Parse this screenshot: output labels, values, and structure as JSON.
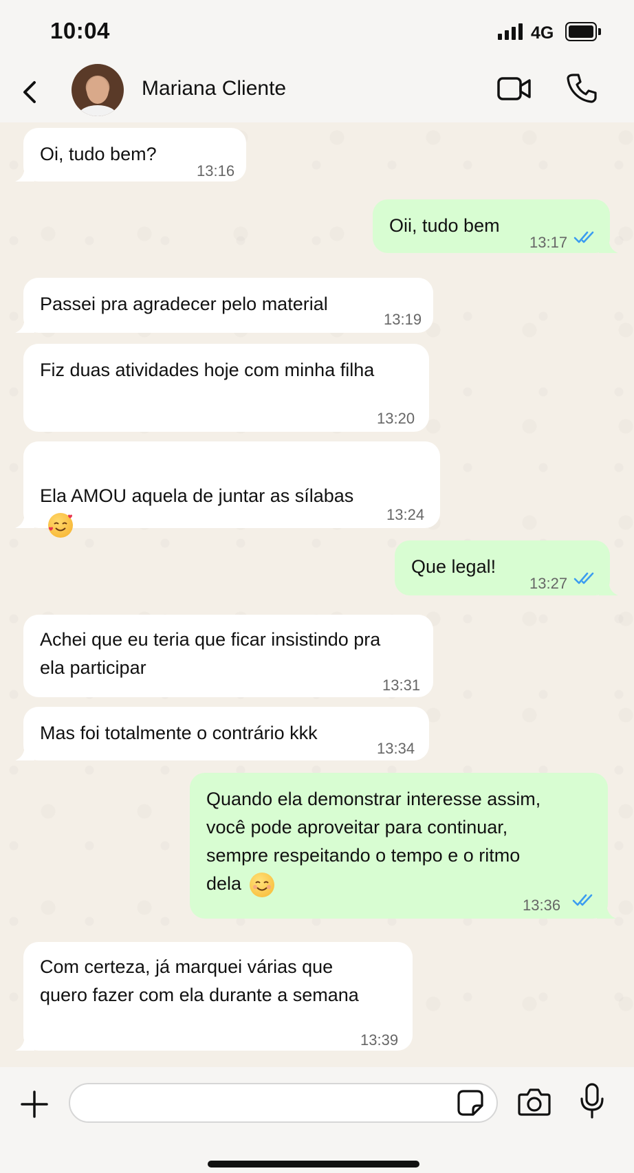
{
  "status_bar": {
    "time": "10:04",
    "network": "4G",
    "signal_icon": "signal-bars-icon",
    "battery_icon": "battery-full-icon"
  },
  "header": {
    "back_icon": "chevron-left-icon",
    "contact_name": "Mariana Cliente",
    "video_icon": "video-camera-icon",
    "call_icon": "phone-icon"
  },
  "messages": [
    {
      "direction": "in",
      "text": "Oi, tudo bem?",
      "time": "13:16"
    },
    {
      "direction": "out",
      "text": "Oii, tudo bem",
      "time": "13:17",
      "status": "read"
    },
    {
      "direction": "in",
      "text": "Passei pra agradecer pelo material",
      "time": "13:19"
    },
    {
      "direction": "in",
      "text": "Fiz duas atividades hoje com minha filha",
      "time": "13:20"
    },
    {
      "direction": "in",
      "text": "Ela AMOU aquela de juntar as sílabas",
      "emoji": "smiling-face-with-hearts",
      "time": "13:24"
    },
    {
      "direction": "out",
      "text": "Que legal!",
      "time": "13:27",
      "status": "read"
    },
    {
      "direction": "in",
      "text": "Achei que eu teria que ficar insistindo pra\nela participar",
      "time": "13:31"
    },
    {
      "direction": "in",
      "text": "Mas foi totalmente o contrário kkk",
      "time": "13:34"
    },
    {
      "direction": "out",
      "text": "Quando ela demonstrar interesse assim,\nvocê pode aproveitar para continuar,\nsempre respeitando o tempo e o ritmo\ndela",
      "emoji": "smiling-face-with-smiling-eyes",
      "time": "13:36",
      "status": "read"
    },
    {
      "direction": "in",
      "text": "Com certeza, já marquei várias que\nquero fazer com ela durante a semana",
      "time": "13:39"
    }
  ],
  "composer": {
    "placeholder": "",
    "plus_icon": "plus-icon",
    "sticker_icon": "sticker-icon",
    "camera_icon": "camera-icon",
    "mic_icon": "microphone-icon"
  },
  "colors": {
    "incoming_bubble": "#ffffff",
    "outgoing_bubble": "#d8fdd2",
    "read_ticks": "#3b9cf0",
    "chat_background": "#f4efe7"
  }
}
